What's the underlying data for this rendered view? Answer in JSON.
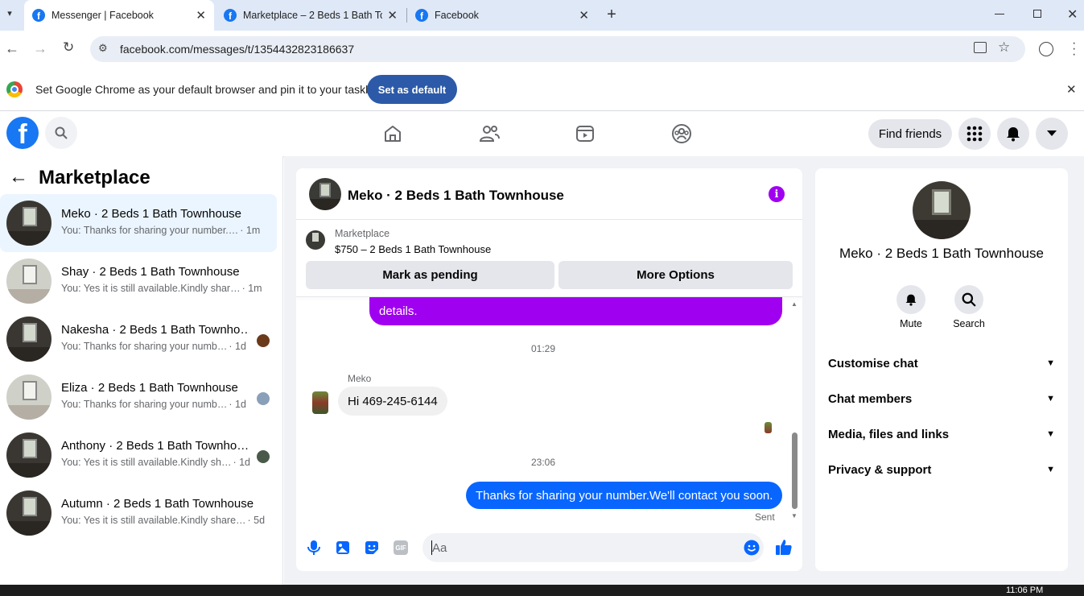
{
  "browser": {
    "tabs": [
      {
        "title": "Messenger | Facebook"
      },
      {
        "title": "Marketplace – 2 Beds 1 Bath To"
      },
      {
        "title": "Facebook"
      }
    ],
    "new_tab_icon": "plus-icon",
    "url": "facebook.com/messages/t/1354432823186637",
    "infobar": {
      "text": "Set Google Chrome as your default browser and pin it to your taskbar",
      "button": "Set as default"
    }
  },
  "fb_header": {
    "find_friends": "Find friends",
    "nav_icons": [
      "home-icon",
      "friends-icon",
      "watch-icon",
      "groups-icon"
    ]
  },
  "sidebar": {
    "title": "Marketplace",
    "conversations": [
      {
        "name": "Meko · 2 Beds 1 Bath Townhouse",
        "preview": "You: Thanks for sharing your number.…",
        "time": "· 1m"
      },
      {
        "name": "Shay · 2 Beds 1 Bath Townhouse",
        "preview": "You: Yes it is still available.Kindly shar…",
        "time": "· 1m"
      },
      {
        "name": "Nakesha · 2 Beds 1 Bath Townho…",
        "preview": "You: Thanks for sharing your numb…",
        "time": "· 1d"
      },
      {
        "name": "Eliza · 2 Beds 1 Bath Townhouse",
        "preview": "You: Thanks for sharing your numb…",
        "time": "· 1d"
      },
      {
        "name": "Anthony · 2 Beds 1 Bath Townho…",
        "preview": "You: Yes it is still available.Kindly sh…",
        "time": "· 1d"
      },
      {
        "name": "Autumn · 2 Beds 1 Bath Townhouse",
        "preview": "You: Yes it is still available.Kindly share…",
        "time": "· 5d"
      }
    ]
  },
  "chat": {
    "title": "Meko · 2 Beds 1 Bath Townhouse",
    "listing": {
      "label": "Marketplace",
      "price_title": "$750 – 2 Beds 1 Bath Townhouse"
    },
    "mark_pending": "Mark as pending",
    "more_options": "More Options",
    "messages": {
      "partial_sent_line2": "details.",
      "time1": "01:29",
      "sender": "Meko",
      "received": "Hi 469-245-6144",
      "time2": "23:06",
      "sent": "Thanks for sharing your number.We'll contact you soon.",
      "status": "Sent"
    },
    "composer_placeholder": "Aa",
    "colors": {
      "accent": "#1877f2",
      "purple": "#a000f0"
    }
  },
  "info_panel": {
    "name": "Meko · 2 Beds 1 Bath Townhouse",
    "mute": "Mute",
    "search": "Search",
    "sections": [
      "Customise chat",
      "Chat members",
      "Media, files and links",
      "Privacy & support"
    ]
  },
  "taskbar": {
    "time": "11:06 PM"
  }
}
